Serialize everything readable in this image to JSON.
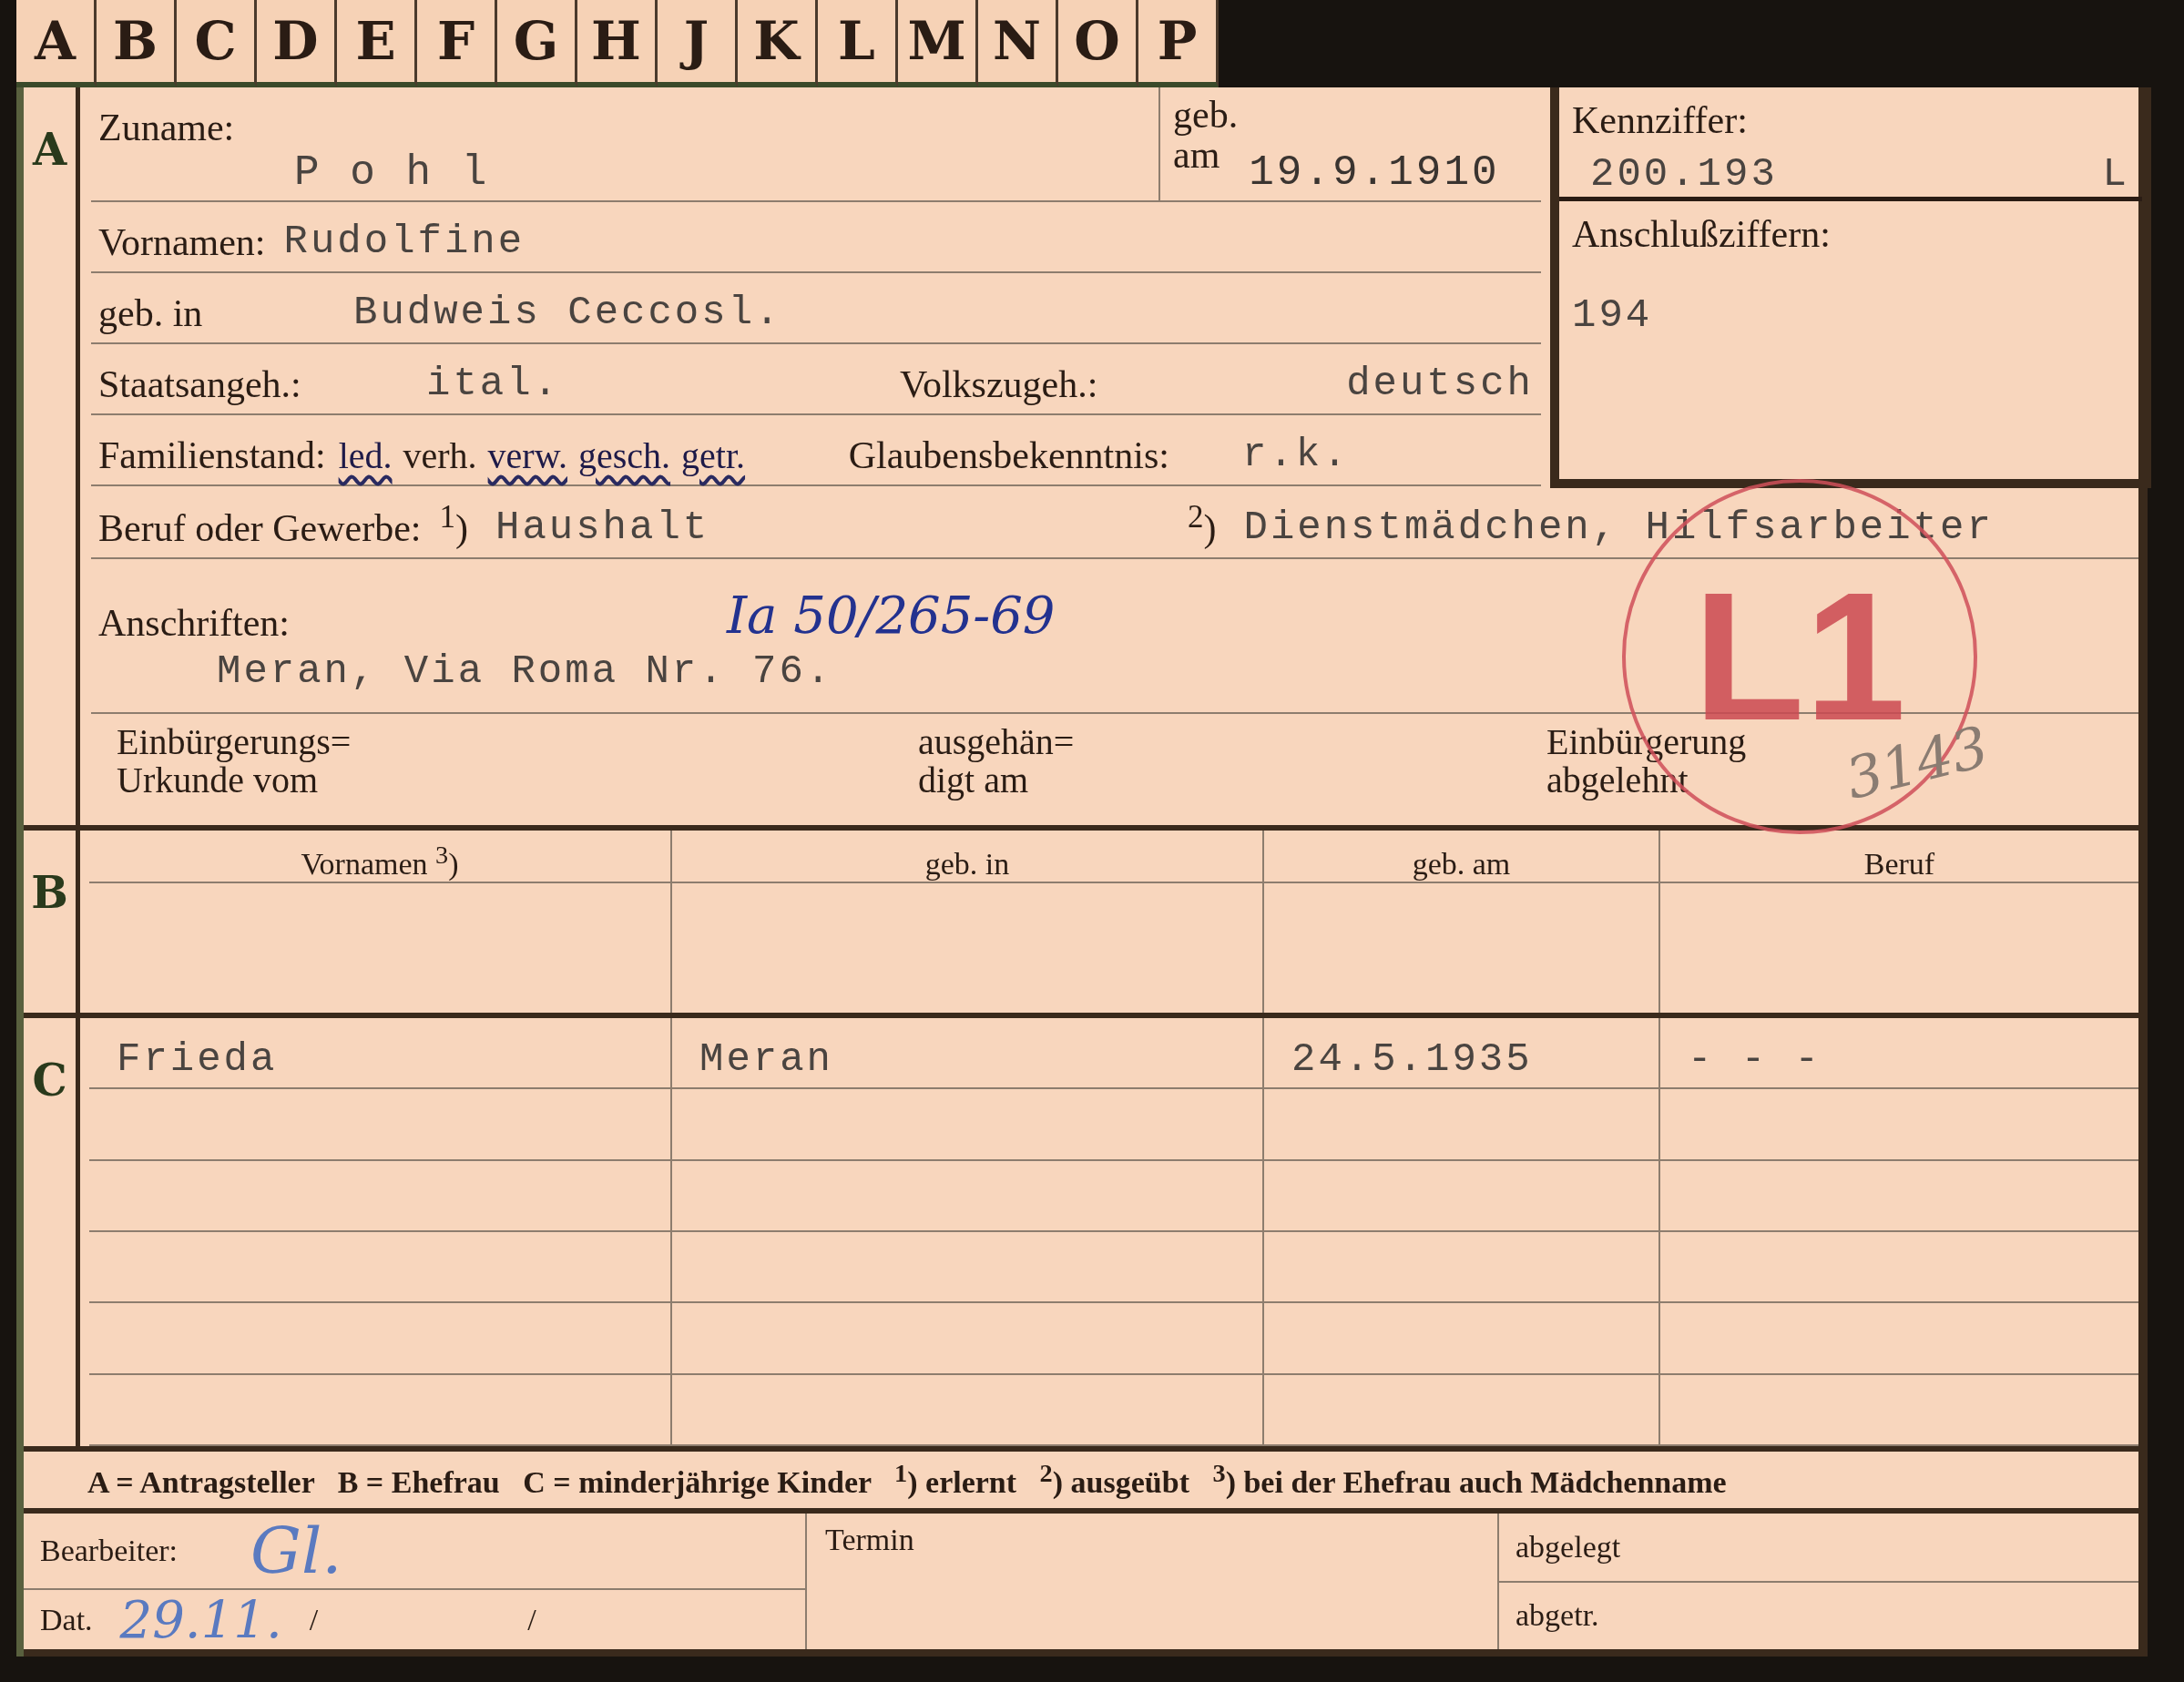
{
  "index_tabs": [
    "A",
    "B",
    "C",
    "D",
    "E",
    "F",
    "G",
    "H",
    "J",
    "K",
    "L",
    "M",
    "N",
    "O",
    "P"
  ],
  "section_a": {
    "marker": "A",
    "zuname": {
      "label": "Zuname:",
      "value": "P o h l"
    },
    "geb_am": {
      "label_1": "geb.",
      "label_2": "am",
      "value": "19.9.1910"
    },
    "kennziffer": {
      "label": "Kennziffer:",
      "value": "200.193",
      "suffix": "L"
    },
    "anschlussziffern": {
      "label": "Anschlußziffern:",
      "value": "194"
    },
    "vornamen": {
      "label": "Vornamen:",
      "value": "Rudolfine"
    },
    "geb_in": {
      "label": "geb. in",
      "value": "Budweis Ceccosl."
    },
    "staatsangeh": {
      "label": "Staatsangeh.:",
      "value": "ital."
    },
    "volkszugeh": {
      "label": "Volkszugeh.:",
      "value": "deutsch"
    },
    "familienstand": {
      "label": "Familienstand:",
      "options": [
        {
          "text": "led.",
          "struck": true
        },
        {
          "text": "verh.",
          "struck": false
        },
        {
          "text": "verw.",
          "struck": true
        },
        {
          "text": "gesch.",
          "struck": true
        },
        {
          "text": "getr.",
          "struck": true
        }
      ]
    },
    "glaubensbekenntnis": {
      "label": "Glaubensbekenntnis:",
      "value": "r.k."
    },
    "beruf": {
      "label": "Beruf oder Gewerbe:",
      "mark_1": "$^{1}$)",
      "learned": "Haushalt",
      "mark_2": "$^{2}$)",
      "practised": "Dienstmädchen, Hilfsarbeiter"
    },
    "anschriften": {
      "label": "Anschriften:",
      "file_ref": "Ia 50/265-69",
      "address": "Meran, Via Roma Nr. 76."
    },
    "einbuergerung": [
      {
        "line_1": "Einbürgerungs=",
        "line_2": "Urkunde vom"
      },
      {
        "line_1": "ausgehän=",
        "line_2": "digt am"
      },
      {
        "line_1": "Einbürgerung",
        "line_2": "abgelehnt"
      }
    ],
    "stamp": "L1",
    "pencil_note": "3143"
  },
  "section_b": {
    "marker": "B",
    "columns": [
      "Vornamen $^{3}$)",
      "geb. in",
      "geb. am",
      "Beruf"
    ]
  },
  "section_c": {
    "marker": "C",
    "rows": [
      [
        "Frieda",
        "Meran",
        "24.5.1935",
        "- - -"
      ]
    ]
  },
  "legend": "A = Antragsteller   B = Ehefrau   C = minderjährige Kinder   $^{1}$) erlernt   $^{2}$) ausgeübt   $^{3}$) bei der Ehefrau auch Mädchenname",
  "footer": {
    "bearbeiter_label": "Bearbeiter:",
    "bearbeiter_sign": "Gl.",
    "dat_label": "Dat.",
    "dat_value": "29.11.",
    "dat_sep_1": "/",
    "dat_sep_2": "/",
    "termin": "Termin",
    "abgelegt": "abgelegt",
    "abgetr": "abgetr."
  }
}
